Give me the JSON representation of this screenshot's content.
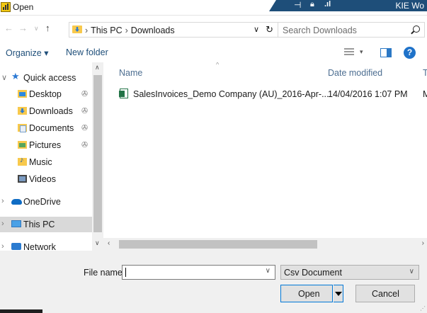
{
  "window": {
    "title": "Open",
    "band_title": "KIE Wo"
  },
  "address": {
    "crumbs": [
      "This PC",
      "Downloads"
    ],
    "search_placeholder": "Search Downloads"
  },
  "toolbar": {
    "organize": "Organize ▾",
    "new_folder": "New folder"
  },
  "sidebar": {
    "items": [
      {
        "label": "Quick access",
        "icon": "star-icon"
      },
      {
        "label": "Desktop",
        "icon": "desktop-folder-icon",
        "pinned": true
      },
      {
        "label": "Downloads",
        "icon": "downloads-folder-icon",
        "pinned": true
      },
      {
        "label": "Documents",
        "icon": "documents-folder-icon",
        "pinned": true
      },
      {
        "label": "Pictures",
        "icon": "pictures-folder-icon",
        "pinned": true
      },
      {
        "label": "Music",
        "icon": "music-folder-icon"
      },
      {
        "label": "Videos",
        "icon": "videos-folder-icon"
      },
      {
        "label": "OneDrive",
        "icon": "onedrive-cloud-icon"
      },
      {
        "label": "This PC",
        "icon": "this-pc-icon",
        "selected": true
      },
      {
        "label": "Network",
        "icon": "network-icon"
      }
    ]
  },
  "filelist": {
    "columns": [
      "Name",
      "Date modified",
      "T"
    ],
    "rows": [
      {
        "name": "SalesInvoices_Demo Company (AU)_2016-Apr-...",
        "date": "14/04/2016 1:07 PM",
        "type": "M"
      }
    ]
  },
  "footer": {
    "filename_label": "File name:",
    "filename_value": "",
    "filetype": "Csv Document",
    "open": "Open",
    "cancel": "Cancel"
  },
  "colors": {
    "accent": "#0078d7",
    "band": "#1e4e79",
    "selected": "#d9d9d9"
  }
}
